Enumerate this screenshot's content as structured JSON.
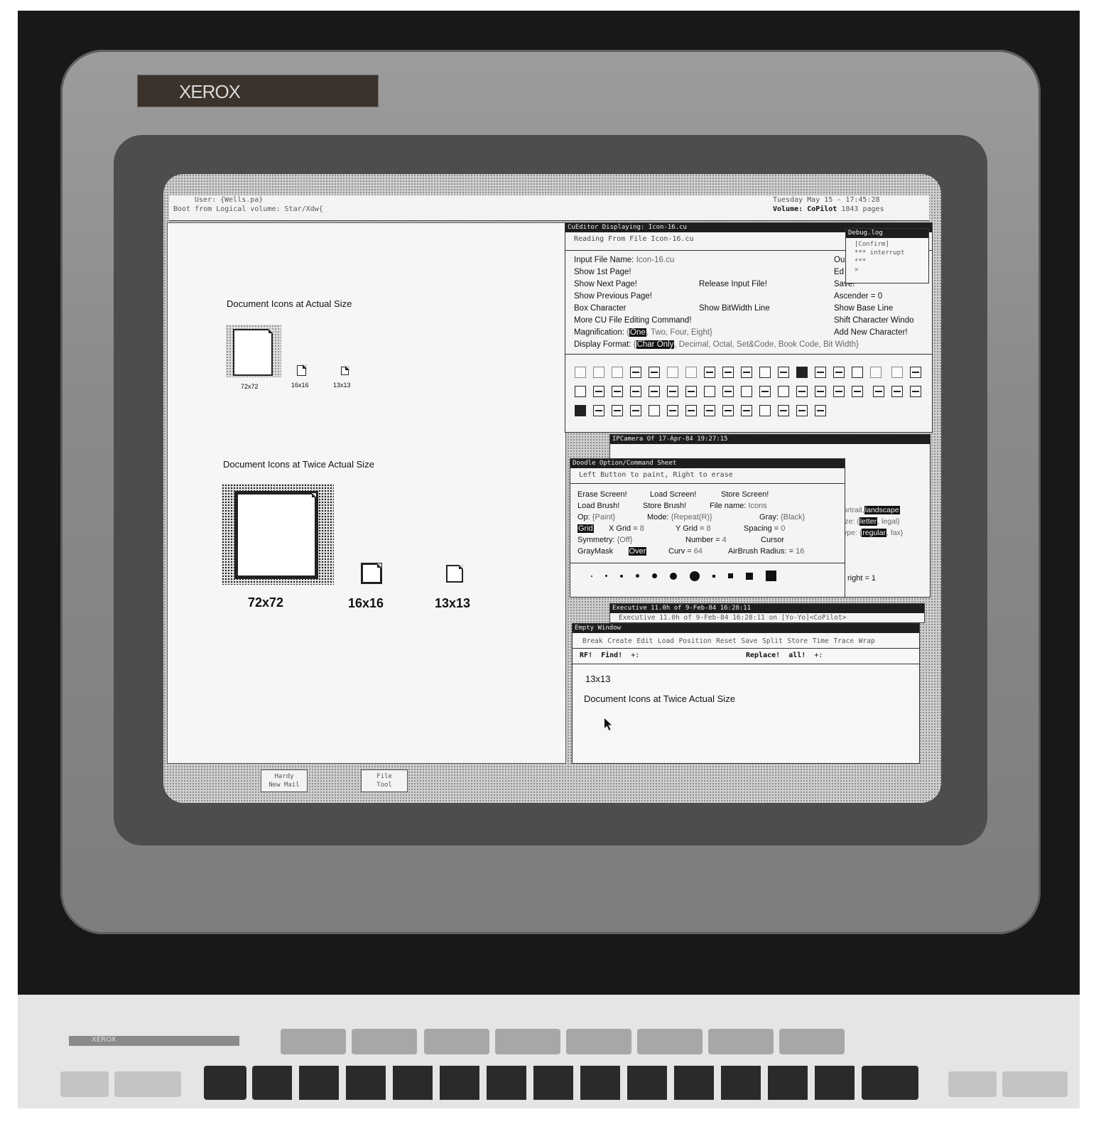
{
  "monitor": {
    "brand": "XEROX"
  },
  "topbar": {
    "user": "User: {Wells.pa}",
    "boot": "Boot from Logical volume: Star/Xdw{",
    "datetime": "Tuesday May 15 - 17:45:28",
    "volume_label": "Volume:",
    "volume_name": "CoPilot",
    "pages": "1843 pages"
  },
  "left_pane": {
    "heading_actual": "Document Icons at Actual Size",
    "heading_twice": "Document Icons at Twice Actual Size",
    "sizes_actual": [
      "72x72",
      "16x16",
      "13x13"
    ],
    "sizes_twice": [
      "72x72",
      "16x16",
      "13x13"
    ]
  },
  "cueditor": {
    "title": "CuEditor Displaying: Icon-16.cu",
    "status": "Reading From File Icon-16.cu",
    "input_label": "Input File Name:",
    "input_value": "Icon-16.cu",
    "cmd_show_first": "Show 1st Page!",
    "cmd_show_next": "Show Next Page!",
    "cmd_show_prev": "Show Previous Page!",
    "cmd_box_char": "Box Character",
    "cmd_more": "More CU File Editing Command!",
    "cmd_release": "Release Input File!",
    "cmd_show_bitwidth": "Show BitWidth Line",
    "magnification_label": "Magnification:",
    "magnification_selected": "One",
    "magnification_rest": ", Two, Four, Eight}",
    "display_format_label": "Display Format:",
    "display_format_selected": "Char Only",
    "display_format_rest": ", Decimal, Octal, Set&Code, Book Code, Bit Width}",
    "right_col": [
      "Ou",
      "Ed",
      "Save!",
      "Ascender = 0",
      "Show Base Line",
      "Shift Character Windo",
      "Add New Character!"
    ]
  },
  "debug_log": {
    "title": "Debug.log",
    "lines": [
      "[Confirm]",
      "*** interrupt",
      "***",
      ">"
    ]
  },
  "ipcamera": {
    "title": "IPCamera Of 17-Apr-84 19:27:15",
    "orient_partial": "ortrait,",
    "orient_selected": "landscape",
    "size_partial": "ize: {",
    "size_selected": "letter",
    "size_rest": ", legal}",
    "type_partial": "ype: {",
    "type_selected": "regular",
    "type_rest": ", fax}",
    "right_label": "right = 1"
  },
  "doodle": {
    "title": "Doodle Option/Command Sheet",
    "hint": "Left Button to paint, Right to erase",
    "erase": "Erase Screen!",
    "load_screen": "Load Screen!",
    "store_screen": "Store Screen!",
    "load_brush": "Load Brush!",
    "store_brush": "Store Brush!",
    "file_name_label": "File name:",
    "file_name_value": "Icons",
    "op_label": "Op:",
    "op_value": "{Paint}",
    "mode_label": "Mode:",
    "mode_value": "{Repeat(R)}",
    "gray_label": "Gray:",
    "gray_value": "{Black}",
    "grid": "Grid",
    "xgrid_label": "X Grid =",
    "xgrid_value": "8",
    "ygrid_label": "Y Grid =",
    "ygrid_value": "8",
    "spacing_label": "Spacing =",
    "spacing_value": "0",
    "symmetry_label": "Symmetry:",
    "symmetry_value": "{Off}",
    "number_label": "Number =",
    "number_value": "4",
    "cursor_label": "Cursor",
    "graymask_label": "GrayMask",
    "graymask_value": "Over",
    "curv_label": "Curv =",
    "curv_value": "64",
    "airbrush_label": "AirBrush Radius: =",
    "airbrush_value": "16"
  },
  "executive": {
    "title": "Executive 11.0h of  9-Feb-84 16:28:11",
    "subtitle": "Executive 11.0h of  9-Feb-84 16:28:11 on [Yo-Yo]<CoPilot>"
  },
  "empty_window": {
    "title": "Empty Window",
    "menu": [
      "Break",
      "Create",
      "Edit",
      "Load",
      "Position",
      "Reset",
      "Save",
      "Split",
      "Store",
      "Time",
      "Trace",
      "Wrap"
    ],
    "rf": "RF!",
    "find": "Find!",
    "find_arrow": "+:",
    "replace": "Replace!",
    "all": "all!",
    "replace_arrow": "+:",
    "line1": "13x13",
    "line2": "Document Icons at Twice Actual Size"
  },
  "tray_icons": [
    {
      "line1": "Hardy",
      "line2": "New Mail"
    },
    {
      "line1": "File",
      "line2": "Tool"
    }
  ]
}
